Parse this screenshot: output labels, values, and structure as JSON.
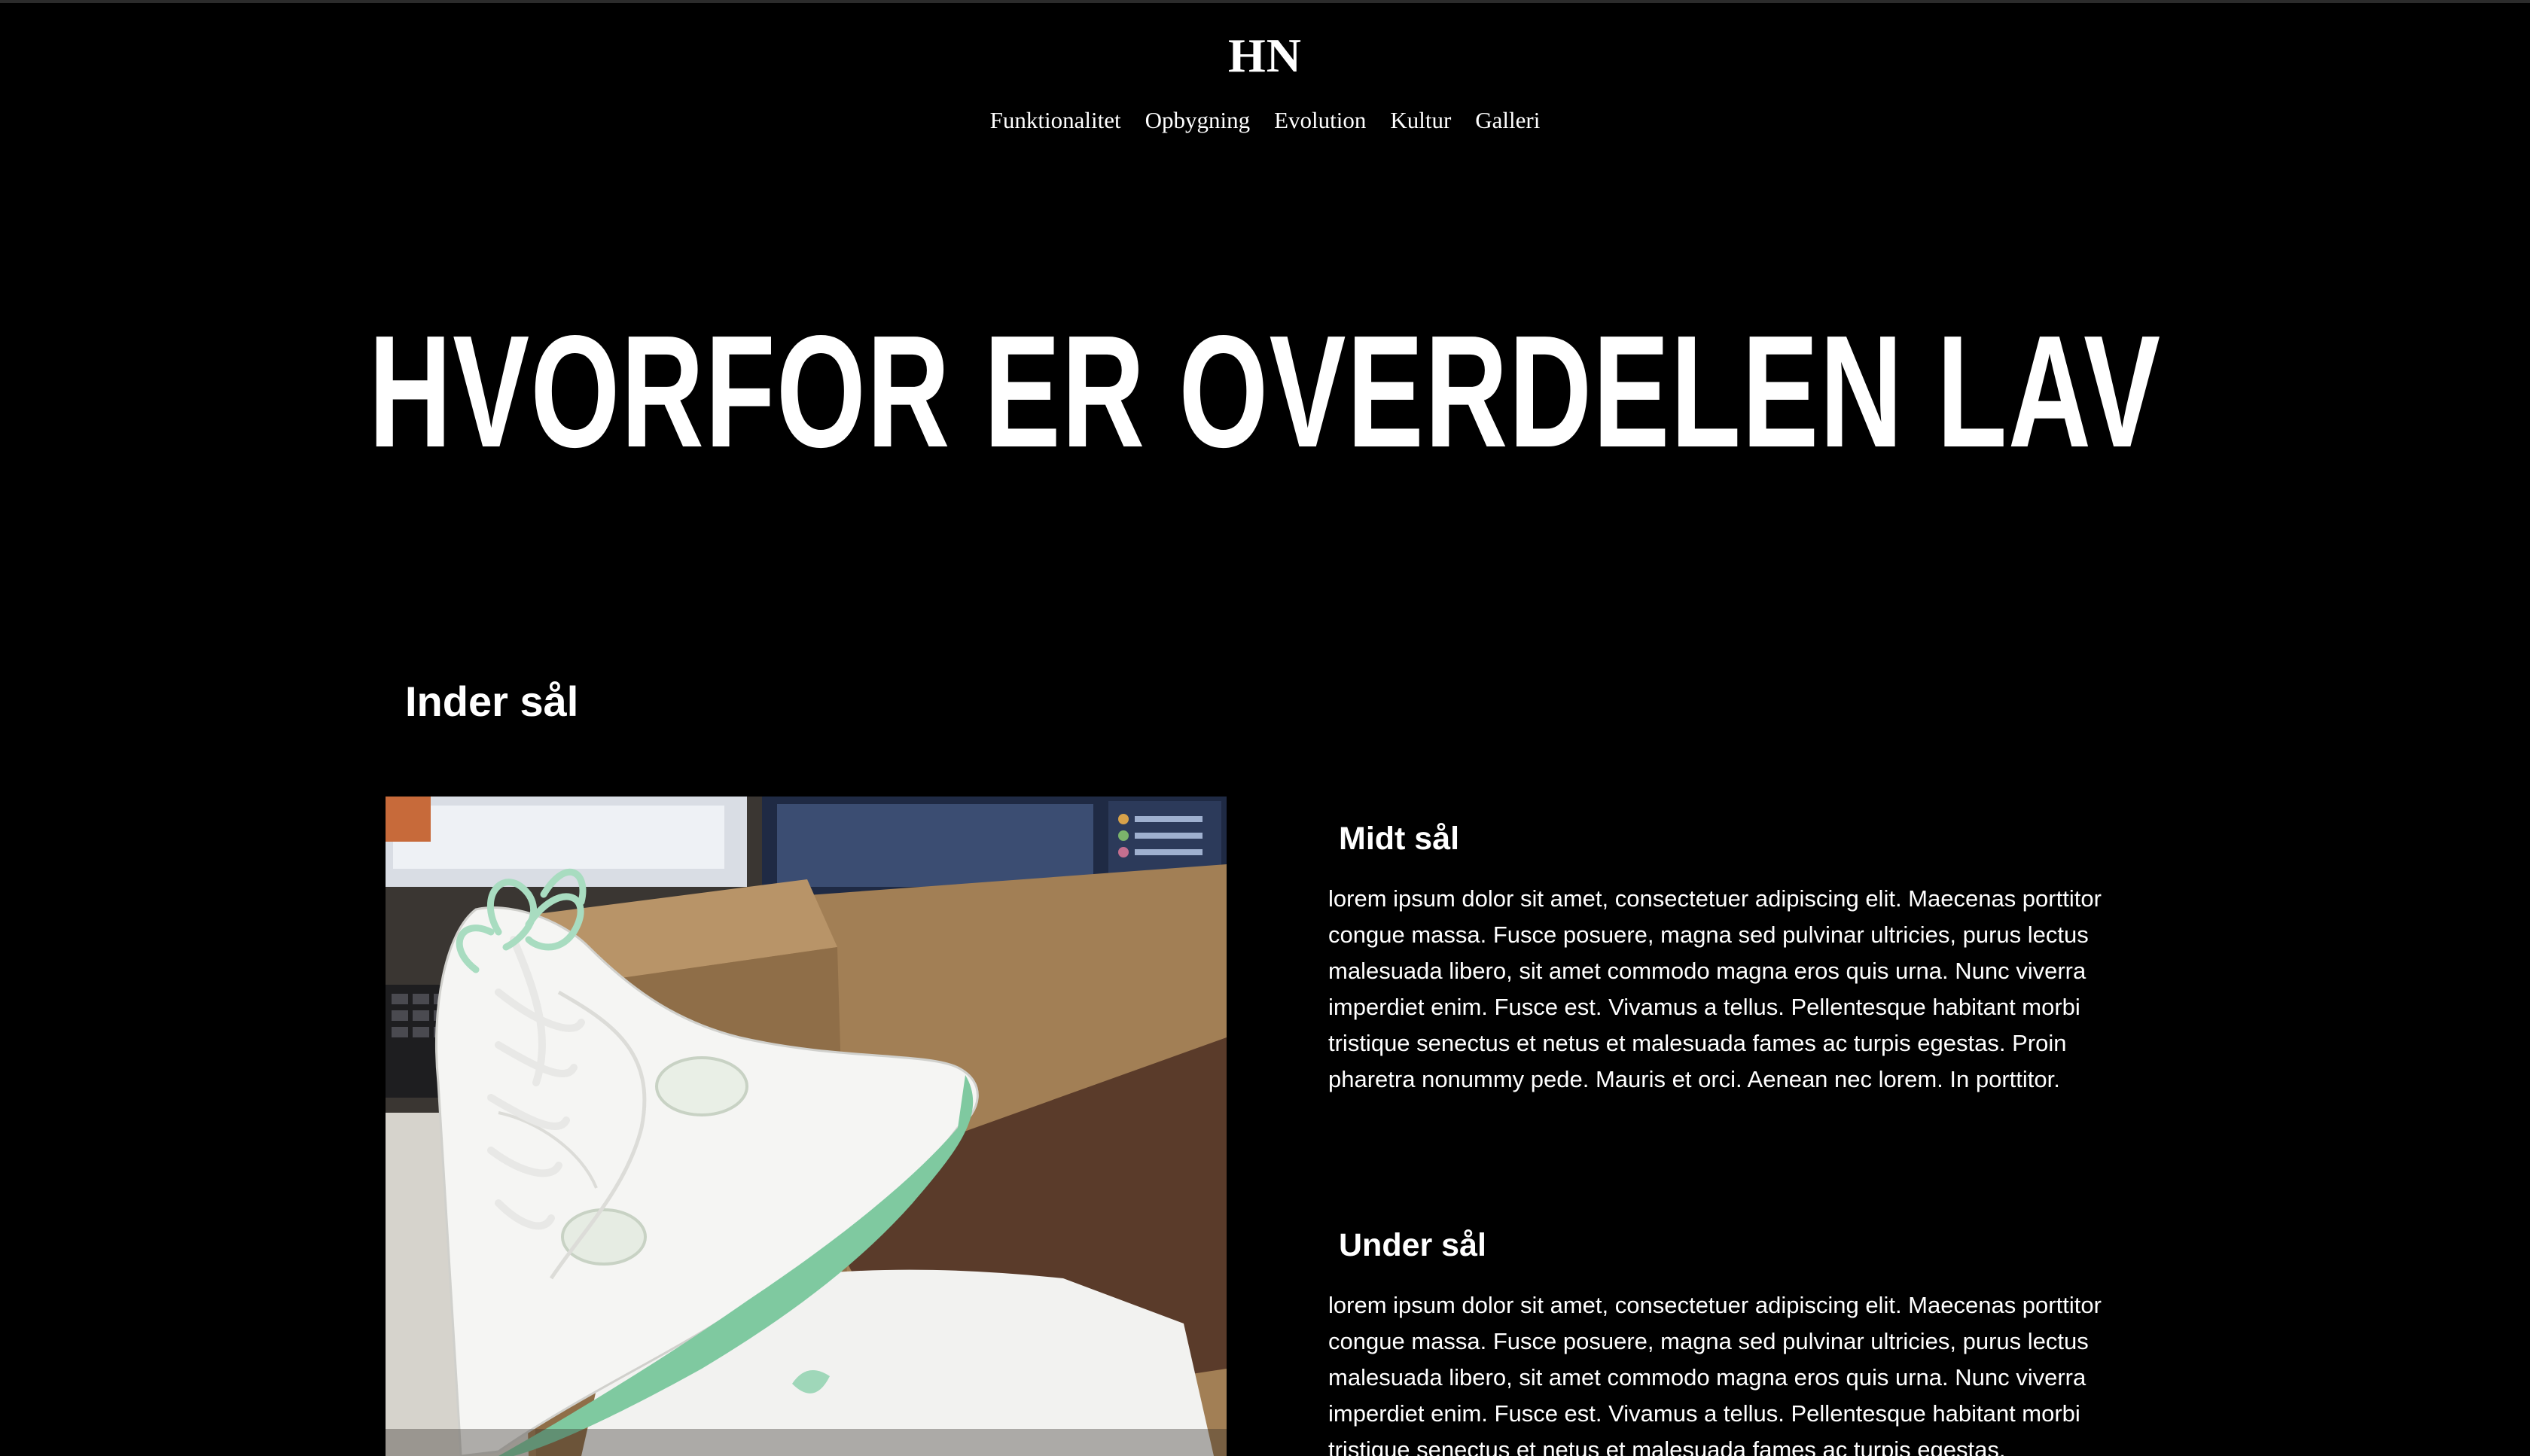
{
  "header": {
    "logo": "HN",
    "nav": [
      "Funktionalitet",
      "Opbygning",
      "Evolution",
      "Kultur",
      "Galleri"
    ]
  },
  "hero": {
    "title": "HVORFOR ER OVERDELEN LAV"
  },
  "section": {
    "heading": "Inder sål",
    "image_subject": "White high-top basketball sneaker with mint green laces and sole held in hand over a cardboard box",
    "blocks": [
      {
        "heading": "Midt sål",
        "text": "lorem ipsum dolor sit amet, consectetuer adipiscing elit. Maecenas porttitor congue massa. Fusce posuere, magna sed pulvinar ultricies, purus lectus malesuada libero, sit amet commodo magna eros quis urna. Nunc viverra imperdiet enim. Fusce est. Vivamus a tellus. Pellentesque habitant morbi tristique senectus et netus et malesuada fames ac turpis egestas. Proin pharetra nonummy pede. Mauris et orci. Aenean nec lorem. In porttitor."
      },
      {
        "heading": "Under sål",
        "text": "lorem ipsum dolor sit amet, consectetuer adipiscing elit. Maecenas porttitor congue massa. Fusce posuere, magna sed pulvinar ultricies, purus lectus malesuada libero, sit amet commodo magna eros quis urna. Nunc viverra imperdiet enim. Fusce est. Vivamus a tellus. Pellentesque habitant morbi tristique senectus et netus et malesuada fames ac turpis egestas."
      }
    ]
  },
  "colors": {
    "background": "#000000",
    "text": "#ffffff",
    "sneaker_accent": "#7fc9a0"
  }
}
